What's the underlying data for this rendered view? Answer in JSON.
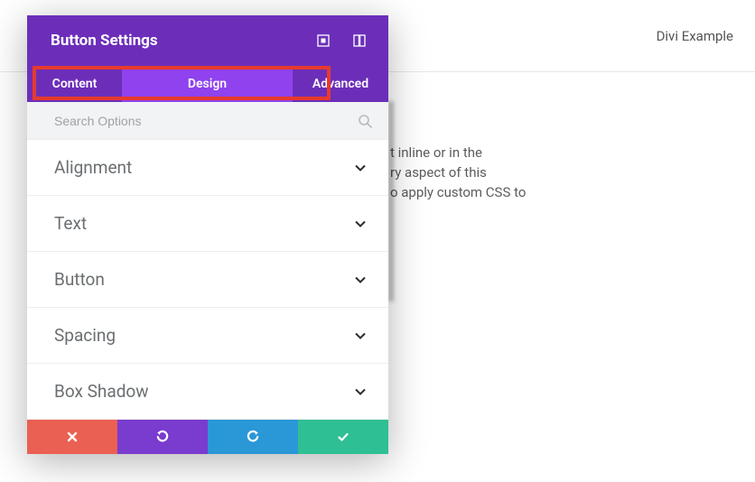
{
  "topbar": {
    "label": "Divi Example"
  },
  "bg": {
    "l1": "t inline or in the",
    "l2": "ry aspect of this",
    "l3": "o apply custom CSS to"
  },
  "header": {
    "title": "Button Settings"
  },
  "tabs": {
    "content": "Content",
    "design": "Design",
    "advanced": "Advanced"
  },
  "search": {
    "placeholder": "Search Options"
  },
  "acc": {
    "alignment": "Alignment",
    "text": "Text",
    "button": "Button",
    "spacing": "Spacing",
    "boxshadow": "Box Shadow"
  }
}
